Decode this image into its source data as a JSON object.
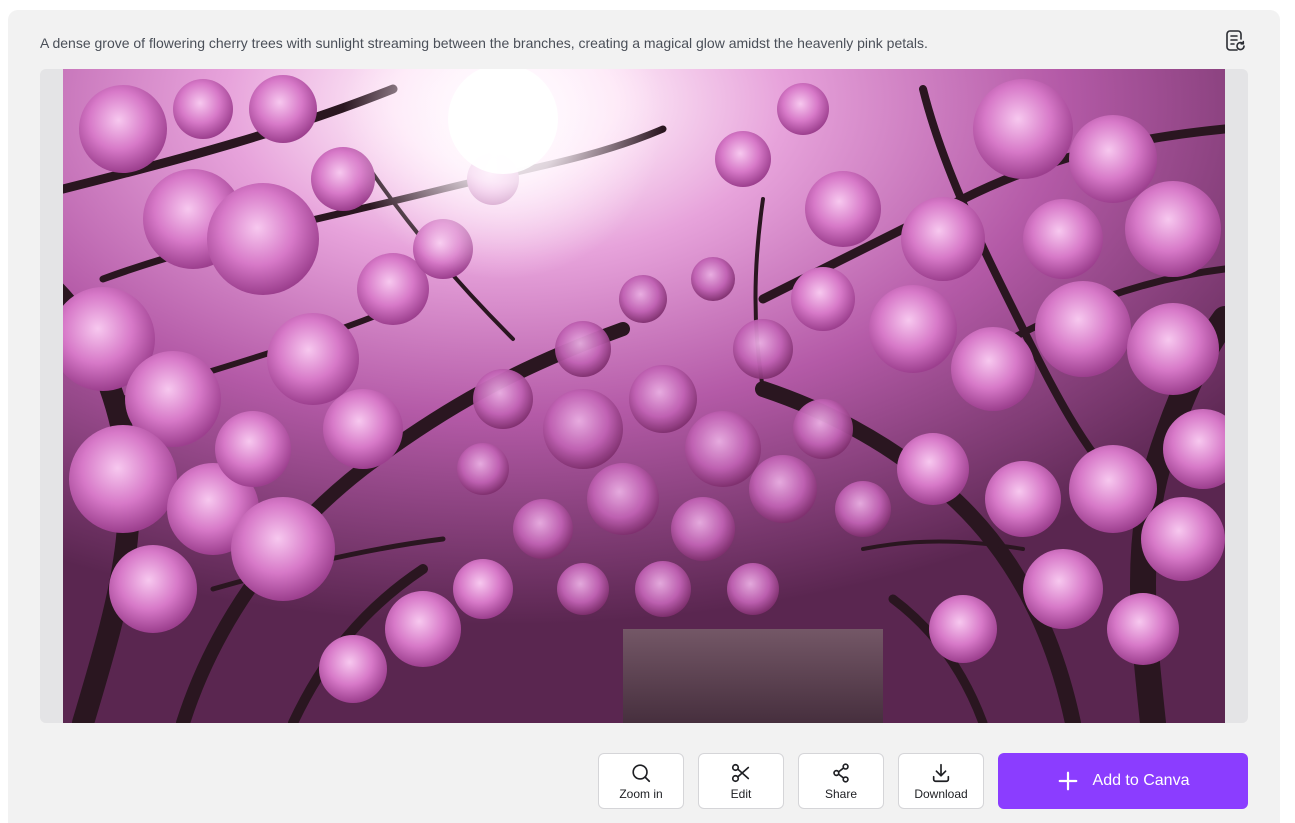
{
  "caption": "A dense grove of flowering cherry trees with sunlight streaming between the branches, creating a magical glow amidst the heavenly pink petals.",
  "image": {
    "alt": "",
    "icon": "generated-image"
  },
  "header_action": {
    "icon": "document-refresh-icon"
  },
  "toolbar": {
    "zoom": {
      "label": "Zoom in",
      "icon": "search-icon"
    },
    "edit": {
      "label": "Edit",
      "icon": "scissors-icon"
    },
    "share": {
      "label": "Share",
      "icon": "share-icon"
    },
    "download": {
      "label": "Download",
      "icon": "download-icon"
    },
    "add": {
      "label": "Add to Canva",
      "icon": "plus-icon"
    }
  },
  "colors": {
    "accent": "#8b3dff",
    "panel_bg": "#f2f2f2",
    "caption_text": "#4a4f58"
  }
}
